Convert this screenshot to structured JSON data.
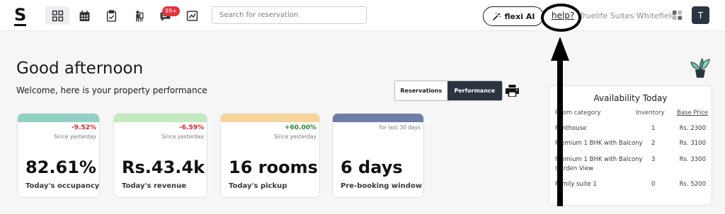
{
  "header": {
    "logo": "S",
    "nav": [
      {
        "icon": "dashboard-icon",
        "active": true
      },
      {
        "icon": "calendar-icon",
        "active": false
      },
      {
        "icon": "clipboard-icon",
        "active": false
      },
      {
        "icon": "bellboy-icon",
        "active": false
      },
      {
        "icon": "chat-icon",
        "active": false,
        "badge": "99+"
      },
      {
        "icon": "chart-icon",
        "active": false
      }
    ],
    "search": {
      "placeholder": "Search for reservation",
      "value": ""
    },
    "flexi_label": "flexi AI",
    "help_label": "help?",
    "property_name": "Truelife Suites Whitefield",
    "avatar_initial": "T"
  },
  "main": {
    "greeting": "Good afternoon",
    "subtitle": "Welcome, here is your property performance",
    "toggle": {
      "reservations": "Reservations",
      "performance": "Performance"
    }
  },
  "cards": [
    {
      "color": "#93d1c4",
      "change": "-9.52%",
      "since": "Since yesterday",
      "value": "82.61%",
      "label": "Today's occupancy"
    },
    {
      "color": "#c3eabf",
      "change": "-6.59%",
      "since": "Since yesterday",
      "value": "Rs.43.4k",
      "label": "Today's revenue"
    },
    {
      "color": "#f6d59a",
      "change": "+60.00%",
      "since": "Since yesterday",
      "value": "16 rooms",
      "label": "Today's pickup"
    },
    {
      "color": "#6f7ca8",
      "change": "",
      "since": "for last 30 days",
      "value": "6 days",
      "label": "Pre-booking window"
    }
  ],
  "availability": {
    "title": "Availability Today",
    "columns": [
      "Room category",
      "Inventory",
      "Base Price"
    ],
    "rows": [
      {
        "category": "Penthouse",
        "inventory": "1",
        "price": "Rs. 2300"
      },
      {
        "category": "Premium 1 BHK with Balcony",
        "inventory": "2",
        "price": "Rs. 3100"
      },
      {
        "category": "Premium 1 BHK with Balcony Garden View",
        "inventory": "3",
        "price": "Rs. 3300"
      },
      {
        "category": "Family suite 1",
        "inventory": "0",
        "price": "Rs. 5200"
      }
    ]
  },
  "colors": {
    "brand_dark": "#2b3440",
    "negative": "#e0212b",
    "positive": "#1f8a2d",
    "badge": "#e6303c"
  }
}
